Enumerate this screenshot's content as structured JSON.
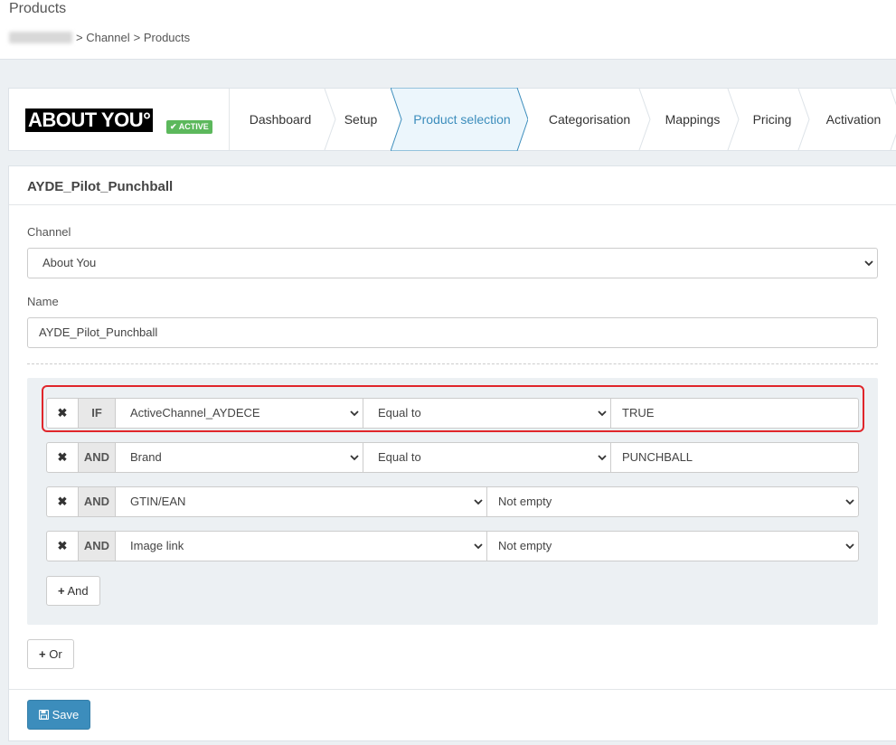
{
  "header": {
    "title": "Products",
    "breadcrumb": [
      "> Channel",
      "> Products"
    ]
  },
  "channel": {
    "logo_text": "ABOUT YOU°",
    "status_badge": "✔ ACTIVE",
    "steps": [
      {
        "label": "Dashboard"
      },
      {
        "label": "Setup"
      },
      {
        "label": "Product selection"
      },
      {
        "label": "Categorisation"
      },
      {
        "label": "Mappings"
      },
      {
        "label": "Pricing"
      },
      {
        "label": "Activation"
      }
    ],
    "active_step": "Product selection"
  },
  "form": {
    "title": "AYDE_Pilot_Punchball",
    "channel_label": "Channel",
    "channel_value": "About You",
    "name_label": "Name",
    "name_value": "AYDE_Pilot_Punchball"
  },
  "rules": [
    {
      "op": "IF",
      "field": "ActiveChannel_AYDECE",
      "condition": "Equal to",
      "value": "TRUE"
    },
    {
      "op": "AND",
      "field": "Brand",
      "condition": "Equal to",
      "value": "PUNCHBALL"
    },
    {
      "op": "AND",
      "field": "GTIN/EAN",
      "condition": "Not empty"
    },
    {
      "op": "AND",
      "field": "Image link",
      "condition": "Not empty"
    }
  ],
  "buttons": {
    "remove": "✖",
    "add_and": "And",
    "add_or": "Or",
    "save": "Save"
  },
  "colors": {
    "accent": "#3c8dbc",
    "active_badge": "#5cb85c",
    "highlight": "#e0262b",
    "background": "#ecf0f3"
  }
}
